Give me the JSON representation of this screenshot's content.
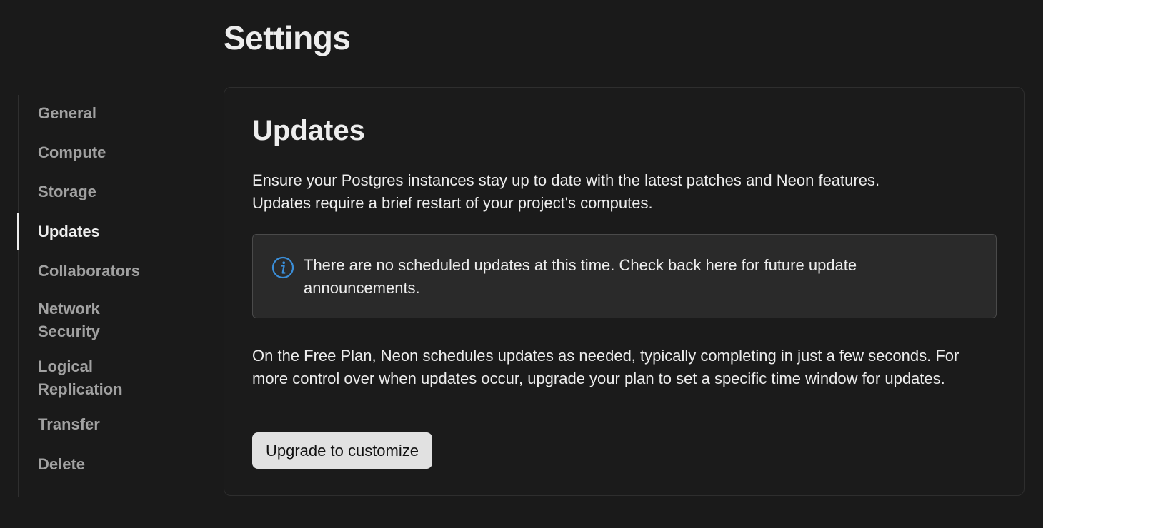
{
  "header": {
    "title": "Settings"
  },
  "sidebar": {
    "items": [
      {
        "label": "General",
        "active": false
      },
      {
        "label": "Compute",
        "active": false
      },
      {
        "label": "Storage",
        "active": false
      },
      {
        "label": "Updates",
        "active": true
      },
      {
        "label": "Collaborators",
        "active": false
      },
      {
        "label": "Network\nSecurity",
        "active": false
      },
      {
        "label": "Logical\nReplication",
        "active": false
      },
      {
        "label": "Transfer",
        "active": false
      },
      {
        "label": "Delete",
        "active": false
      }
    ]
  },
  "main": {
    "section_title": "Updates",
    "description_line1": "Ensure your Postgres instances stay up to date with the latest patches and Neon features.",
    "description_line2": "Updates require a brief restart of your project's computes.",
    "info_icon": "info-circle-icon",
    "info_message": "There are no scheduled updates at this time. Check back here for future update announcements.",
    "plan_text": "On the Free Plan, Neon schedules updates as needed, typically completing in just a few seconds. For more control over when updates occur, upgrade your plan to set a specific time window for updates.",
    "upgrade_button": "Upgrade to customize"
  },
  "colors": {
    "background": "#1a1a1a",
    "text": "#ededed",
    "muted_text": "#a1a1a1",
    "info_icon": "#3b8ed8",
    "button_bg": "#e1e1e1"
  }
}
